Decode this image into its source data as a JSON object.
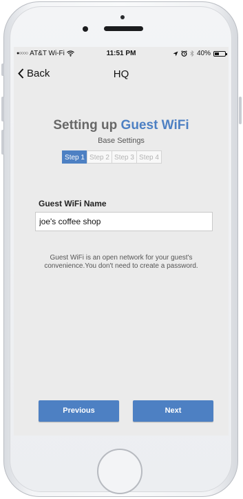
{
  "status_bar": {
    "signal": "●○○○○",
    "carrier": "AT&T Wi-Fi",
    "wifi_icon": "wifi-icon",
    "time": "11:51 PM",
    "location_icon": "location-arrow-icon",
    "alarm_icon": "alarm-clock-icon",
    "bluetooth_icon": "bluetooth-icon",
    "battery_percent": "40%",
    "battery_level": 0.4
  },
  "nav": {
    "back_label": "Back",
    "title": "HQ"
  },
  "heading": {
    "prefix": "Setting up",
    "accent": "Guest WiFi",
    "accent_color": "#4d80c3"
  },
  "subheading": "Base Settings",
  "steps": [
    {
      "label": "Step 1",
      "active": true
    },
    {
      "label": "Step 2",
      "active": false
    },
    {
      "label": "Step 3",
      "active": false
    },
    {
      "label": "Step 4",
      "active": false
    }
  ],
  "form": {
    "label": "Guest WiFi Name",
    "value": "joe's coffee shop"
  },
  "help": {
    "line1": "Guest WiFi is an open network for your guest's",
    "line2": "convenience.You don't need to create a password."
  },
  "buttons": {
    "previous": "Previous",
    "next": "Next"
  }
}
